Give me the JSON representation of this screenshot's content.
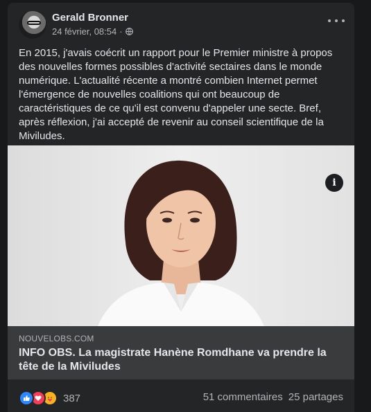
{
  "post": {
    "author": "Gerald Bronner",
    "date": "24 février, 08:54",
    "separator": "·",
    "audience_icon": "globe-icon",
    "menu_icon": "more-options-icon",
    "text": "En 2015, j'avais coécrit un rapport pour le Premier ministre à propos des nouvelles formes possibles d'activité sectaires dans le monde numérique. L'actualité récente a montré combien Internet permet l'émergence de nouvelles coalitions qui ont beaucoup de caractéristiques de ce qu'il est convenu d'appeler une secte. Bref, après réflexion, j'ai accepté de revenir au conseil scientifique de la Miviludes."
  },
  "link": {
    "domain": "NOUVELOBS.COM",
    "title": "INFO OBS. La magistrate Hanène Romdhane va prendre la tête de la Miviludes",
    "info_icon": "info-icon",
    "info_glyph": "i"
  },
  "footer": {
    "reaction_count": "387",
    "comments": "51 commentaires",
    "shares": "25 partages"
  },
  "colors": {
    "background": "#18191a",
    "card": "#242526",
    "link_box": "#3a3b3c",
    "like": "#2d88ff",
    "love": "#f33e58",
    "care": "#f7b125"
  }
}
